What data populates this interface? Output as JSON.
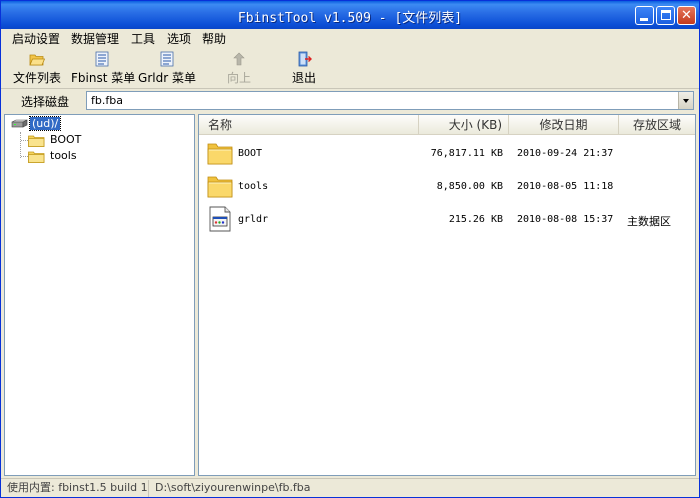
{
  "window": {
    "title": "FbinstTool v1.509 - [文件列表]"
  },
  "menu": [
    "启动设置",
    "数据管理",
    "工具",
    "选项",
    "帮助"
  ],
  "toolbar": {
    "file_list": "文件列表",
    "fbinst_menu": "Fbinst 菜单",
    "grldr_menu": "Grldr 菜单",
    "up": "向上",
    "exit": "退出"
  },
  "address": {
    "label": "选择磁盘",
    "value": "fb.fba"
  },
  "tree": {
    "root": "(ud)/",
    "children": [
      "BOOT",
      "tools"
    ]
  },
  "list": {
    "columns": {
      "name": "名称",
      "size": "大小 (KB)",
      "modified": "修改日期",
      "area": "存放区域"
    },
    "rows": [
      {
        "name": "BOOT",
        "size": "76,817.11 KB",
        "modified": "2010-09-24 21:37",
        "area": "",
        "icon": "folder-icon"
      },
      {
        "name": "tools",
        "size": "8,850.00 KB",
        "modified": "2010-08-05 11:18",
        "area": "",
        "icon": "folder-icon"
      },
      {
        "name": "grldr",
        "size": "215.26 KB",
        "modified": "2010-08-08 15:37",
        "area": "主数据区",
        "icon": "file-icon"
      }
    ]
  },
  "status": {
    "builtin": "使用内置: fbinst1.5 build 1",
    "path": "D:\\soft\\ziyourenwinpe\\fb.fba"
  },
  "colors": {
    "titlebar": "#0b4ed6",
    "selection": "#316ac5",
    "folder": "#f5d35c",
    "chrome": "#ece9d8"
  }
}
